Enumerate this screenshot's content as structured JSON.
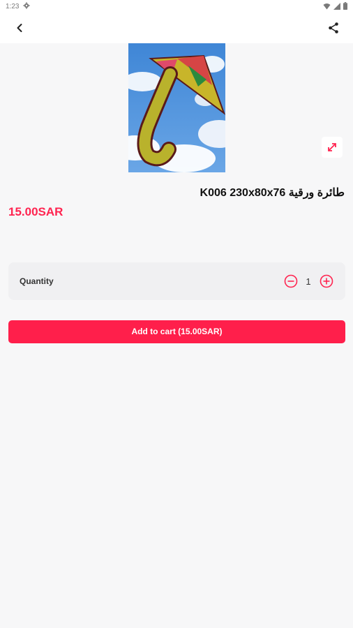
{
  "status_bar": {
    "time": "1:23",
    "icons": [
      "settings-icon",
      "wifi-icon",
      "signal-icon",
      "battery-icon"
    ]
  },
  "app_bar": {
    "back_icon": "chevron-left-icon",
    "share_icon": "share-icon"
  },
  "product": {
    "image_alt": "kite-photo",
    "expand_icon": "expand-icon",
    "title": "طائرة ورقية K006 230x80x76",
    "price": "15.00SAR"
  },
  "quantity": {
    "label": "Quantity",
    "value": "1",
    "minus_icon": "minus-circle-icon",
    "plus_icon": "plus-circle-icon"
  },
  "cart": {
    "button_label": "Add to cart (15.00SAR)"
  },
  "colors": {
    "accent": "#ff1f4b",
    "background": "#f7f7f8",
    "card": "#f0f0f2"
  }
}
